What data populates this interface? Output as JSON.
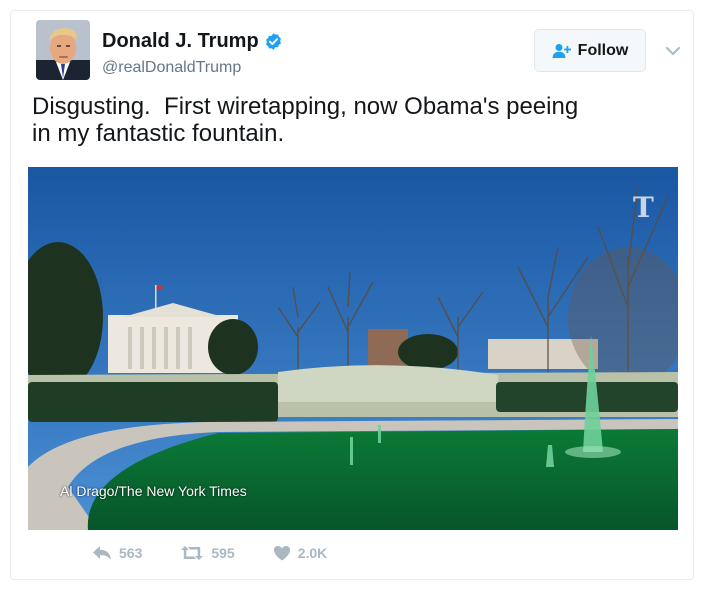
{
  "tweet": {
    "author_name": "Donald J. Trump",
    "handle": "@realDonaldTrump",
    "follow_label": "Follow",
    "text": "Disgusting.  First wiretapping, now Obama's peeing\nin my fantastic fountain.",
    "media": {
      "credit": "Al Drago/The New York Times",
      "logo_glyph": "T"
    },
    "actions": {
      "replies": "563",
      "retweets": "595",
      "likes": "2.0K"
    }
  },
  "colors": {
    "verified": "#1da1f2",
    "icon_gray": "#aab8c2",
    "follow_icon": "#1da1f2",
    "fountain_water": "#0e8a3e",
    "sky": "#1f64b0"
  },
  "icons": [
    "verified-badge-icon",
    "follow-person-plus-icon",
    "chevron-down-icon",
    "reply-icon",
    "retweet-icon",
    "heart-icon",
    "nyt-logo"
  ]
}
